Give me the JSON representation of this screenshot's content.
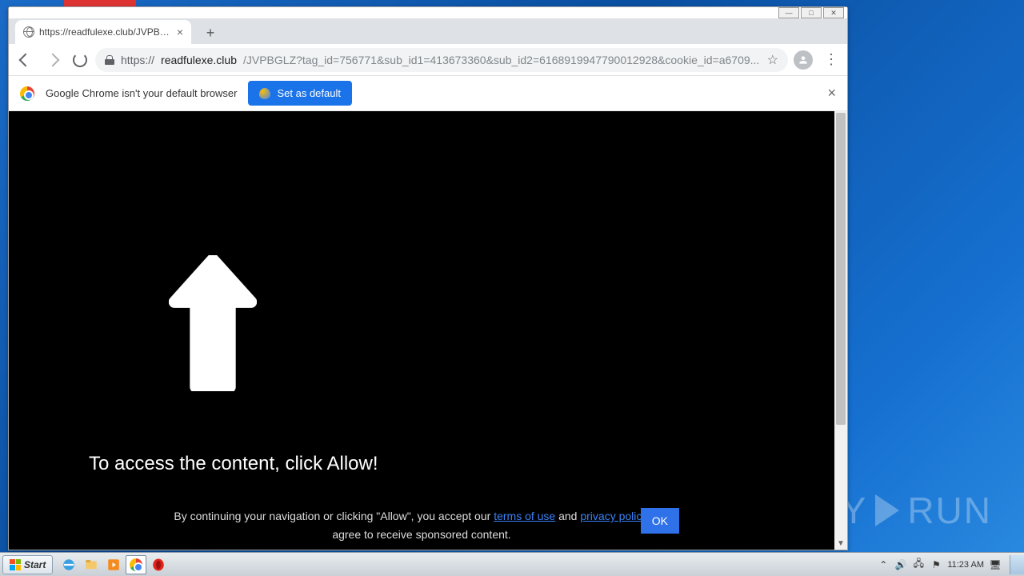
{
  "window": {
    "minimize": "—",
    "maximize": "□",
    "close": "✕"
  },
  "tab": {
    "title": "https://readfulexe.club/JVPBGLZ?ta"
  },
  "address": {
    "prefix": "https://",
    "host": "readfulexe.club",
    "rest": "/JVPBGLZ?tag_id=756771&sub_id1=413673360&sub_id2=6168919947790012928&cookie_id=a6709..."
  },
  "infobar": {
    "message": "Google Chrome isn't your default browser",
    "set_default": "Set as default"
  },
  "page": {
    "headline": "To access the content, click Allow!",
    "consent_pre": "By continuing your navigation or clicking \"Allow\", you accept our ",
    "terms": "terms of use",
    "and": " and ",
    "privacy": "privacy policy",
    "consent_post": " and agree to receive sponsored content.",
    "ok": "OK"
  },
  "taskbar": {
    "start": "Start",
    "time": "11:23 AM"
  },
  "watermark": {
    "brand_left": "ANY",
    "brand_right": "RUN"
  }
}
